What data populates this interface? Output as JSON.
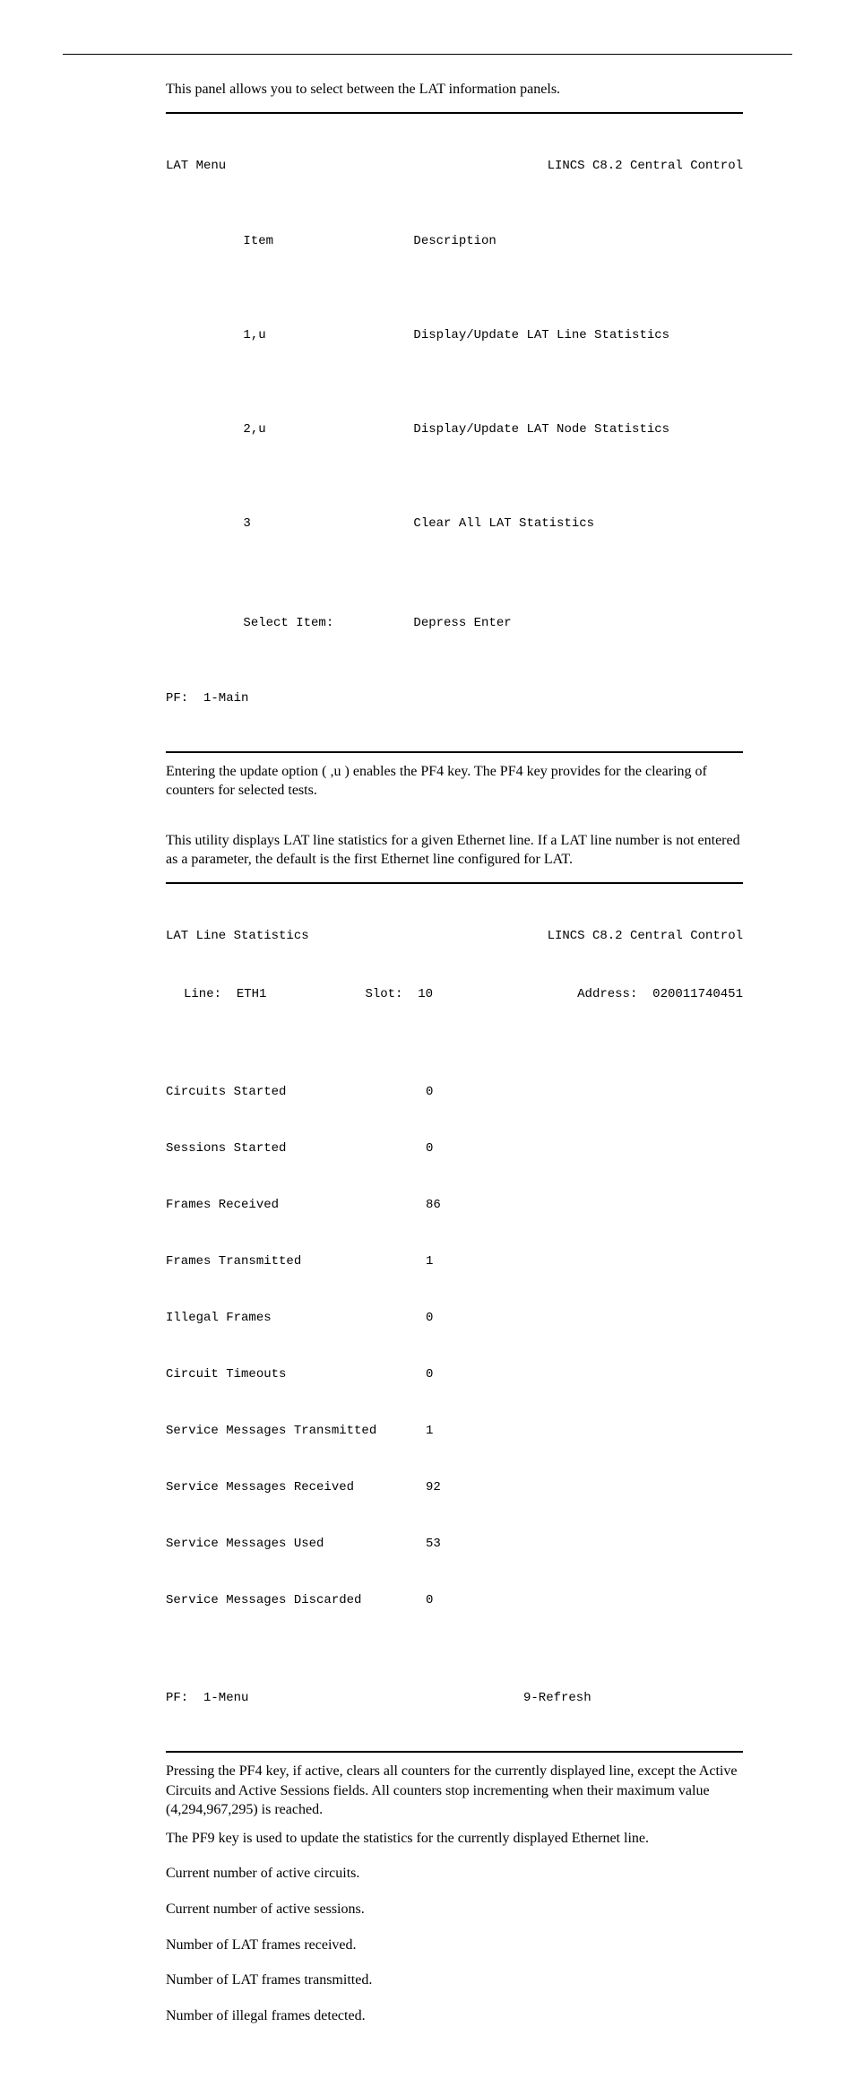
{
  "intro": "This panel allows you to select between the LAT information panels.",
  "panel1": {
    "title_left": "LAT Menu",
    "title_right": "LINCS C8.2 Central Control",
    "head_item": "Item",
    "head_desc": "Description",
    "rows": [
      {
        "item": "1,u",
        "desc": "Display/Update LAT Line Statistics"
      },
      {
        "item": "2,u",
        "desc": "Display/Update LAT Node Statistics"
      },
      {
        "item": "3",
        "desc": "Clear All LAT Statistics"
      }
    ],
    "select_label": "Select Item:",
    "select_action": "Depress Enter",
    "pf": "PF:  1-Main"
  },
  "after_panel1": "Entering the update option ( ,u ) enables the PF4 key. The PF4 key provides for the clearing of counters for selected tests.",
  "before_panel2": "This utility displays LAT line statistics for a given Ethernet line. If a LAT line number is not entered as a parameter, the default is the first Ethernet line configured for LAT.",
  "panel2": {
    "title_left": "LAT Line Statistics",
    "title_right": "LINCS C8.2 Central Control",
    "line_label": "Line:",
    "line_value": "ETH1",
    "slot_label": "Slot:",
    "slot_value": "10",
    "addr_label": "Address:",
    "addr_value": "020011740451",
    "stats": [
      {
        "label": "Circuits Started",
        "value": "0"
      },
      {
        "label": "Sessions Started",
        "value": "0"
      },
      {
        "label": "Frames Received",
        "value": "86"
      },
      {
        "label": "Frames Transmitted",
        "value": "1"
      },
      {
        "label": "Illegal Frames",
        "value": "0"
      },
      {
        "label": "Circuit Timeouts",
        "value": "0"
      },
      {
        "label": "Service Messages Transmitted",
        "value": "1"
      },
      {
        "label": "Service Messages Received",
        "value": "92"
      },
      {
        "label": "Service Messages Used",
        "value": "53"
      },
      {
        "label": "Service Messages Discarded",
        "value": "0"
      }
    ],
    "pf_left": "PF:  1-Menu",
    "pf_right": "9-Refresh"
  },
  "after_panel2_a": "Pressing the PF4 key, if active, clears all counters for the currently displayed line, except the Active Circuits and Active Sessions fields. All counters stop incrementing when their maximum value (4,294,967,295) is reached.",
  "after_panel2_b": "The PF9 key is used to update the statistics for the currently displayed Ethernet line.",
  "definitions": [
    "Current number of active circuits.",
    "Current number of active sessions.",
    "Number of LAT frames received.",
    "Number of LAT frames transmitted.",
    "Number of illegal frames detected."
  ]
}
